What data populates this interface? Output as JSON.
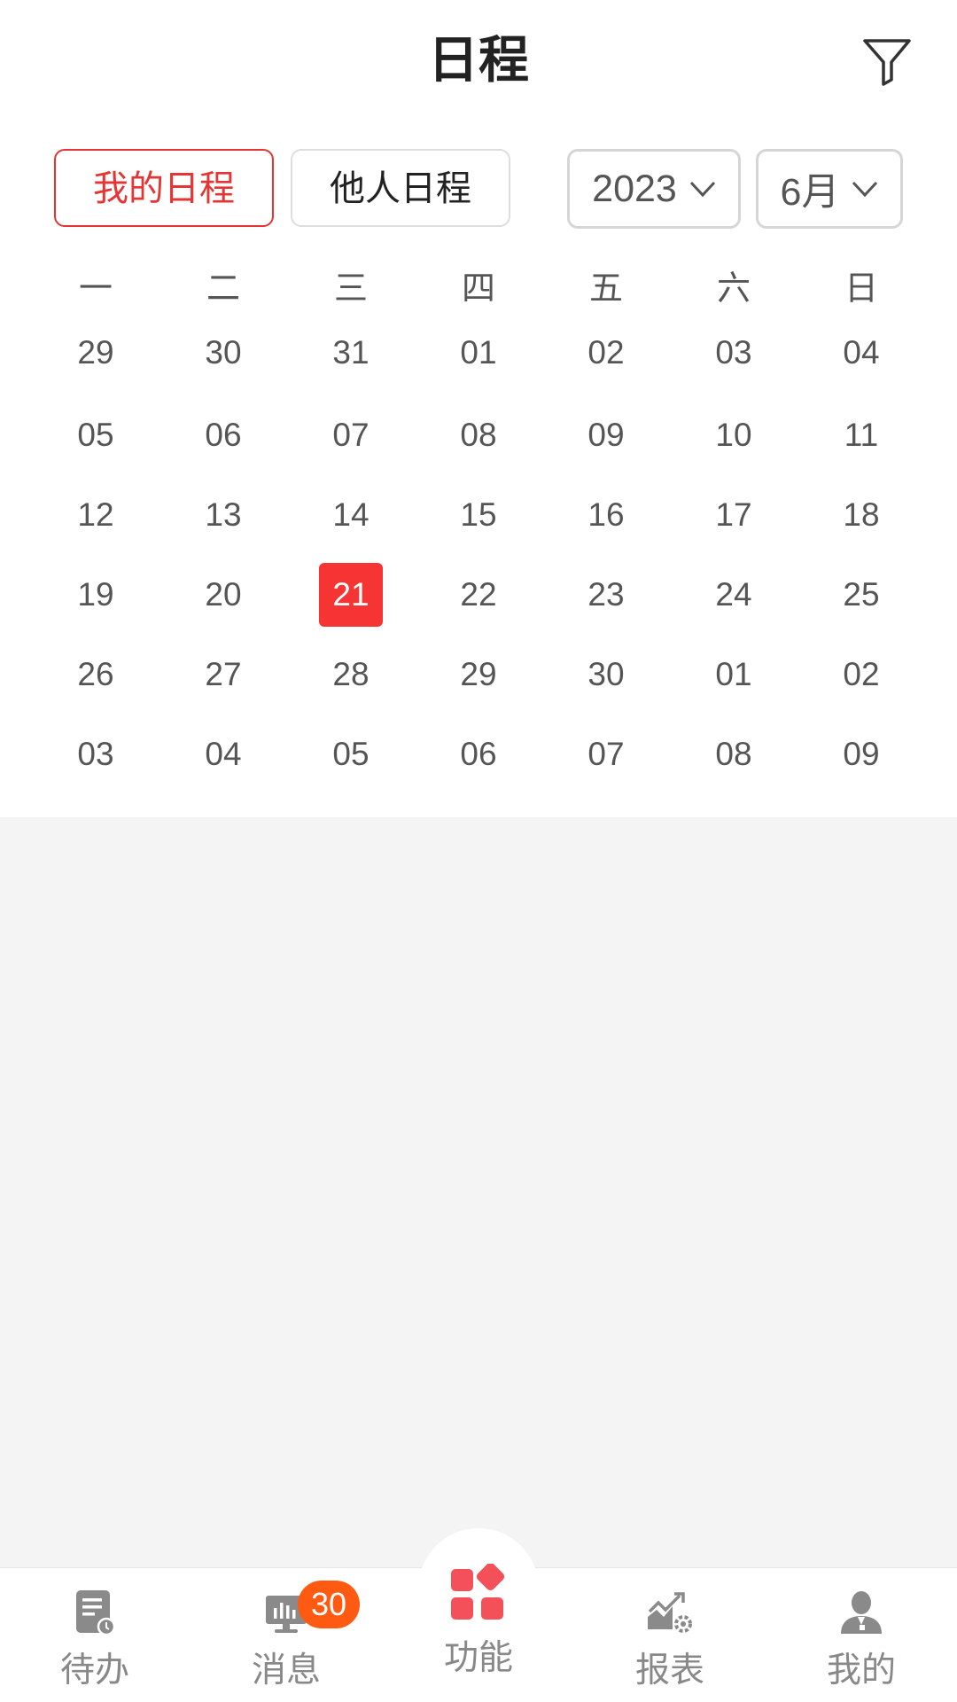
{
  "header": {
    "title": "日程",
    "filter_icon": "filter-icon"
  },
  "segments": {
    "mine": "我的日程",
    "others": "他人日程",
    "active": "mine"
  },
  "selectors": {
    "year": "2023",
    "month": "6月"
  },
  "calendar": {
    "weekdays": [
      "一",
      "二",
      "三",
      "四",
      "五",
      "六",
      "日"
    ],
    "weeks": [
      [
        "29",
        "30",
        "31",
        "01",
        "02",
        "03",
        "04"
      ],
      [
        "05",
        "06",
        "07",
        "08",
        "09",
        "10",
        "11"
      ],
      [
        "12",
        "13",
        "14",
        "15",
        "16",
        "17",
        "18"
      ],
      [
        "19",
        "20",
        "21",
        "22",
        "23",
        "24",
        "25"
      ],
      [
        "26",
        "27",
        "28",
        "29",
        "30",
        "01",
        "02"
      ],
      [
        "03",
        "04",
        "05",
        "06",
        "07",
        "08",
        "09"
      ]
    ],
    "selected": "21"
  },
  "tabbar": {
    "items": [
      {
        "label": "待办",
        "icon": "todo-icon"
      },
      {
        "label": "消息",
        "icon": "message-icon",
        "badge": "30"
      },
      {
        "label": "功能",
        "icon": "functions-icon"
      },
      {
        "label": "报表",
        "icon": "report-icon"
      },
      {
        "label": "我的",
        "icon": "profile-icon"
      }
    ]
  },
  "colors": {
    "accent": "#e63434",
    "selected_day": "#f73434",
    "badge": "#ff5a12",
    "functions_icon": "#f4505a",
    "tab_icon": "#8a8a8a"
  }
}
